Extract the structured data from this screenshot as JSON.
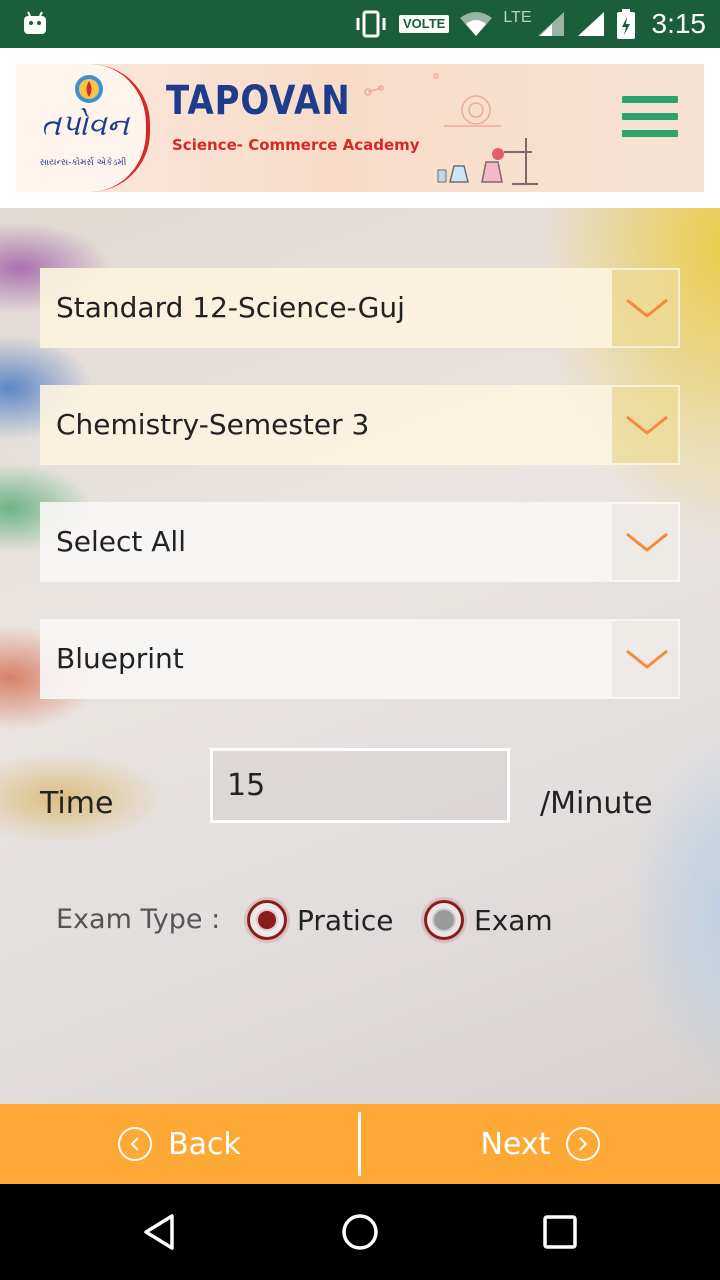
{
  "status_bar": {
    "network_badge": "VOLTE",
    "lte": "LTE",
    "time": "3:15",
    "icons": [
      "android-icon",
      "vibrate-icon",
      "wifi-icon",
      "signal-icon",
      "signal-icon",
      "battery-icon"
    ]
  },
  "header": {
    "brand_title": "TAPOVAN",
    "brand_subtitle": "Science- Commerce Academy",
    "logo_script": "તપોવન",
    "logo_subtext": "સાયન્સ-કોમર્સ એકેડમી",
    "menu_icon": "hamburger-menu-icon",
    "accent_color": "#2ba56b"
  },
  "form": {
    "standard_dropdown": {
      "selected": "Standard 12-Science-Guj"
    },
    "subject_dropdown": {
      "selected": "Chemistry-Semester 3"
    },
    "chapter_dropdown": {
      "selected": "Select All"
    },
    "type_dropdown": {
      "selected": "Blueprint"
    },
    "time": {
      "label": "Time",
      "value": "15",
      "unit": "/Minute"
    },
    "exam_type": {
      "label": "Exam Type :",
      "options": [
        {
          "label": "Pratice",
          "checked": true
        },
        {
          "label": "Exam",
          "checked": false
        }
      ]
    }
  },
  "bottom_bar": {
    "back_label": "Back",
    "next_label": "Next",
    "color": "#fea935"
  },
  "nav_bar": {
    "buttons": [
      "back-triangle-icon",
      "home-circle-icon",
      "recents-square-icon"
    ]
  }
}
